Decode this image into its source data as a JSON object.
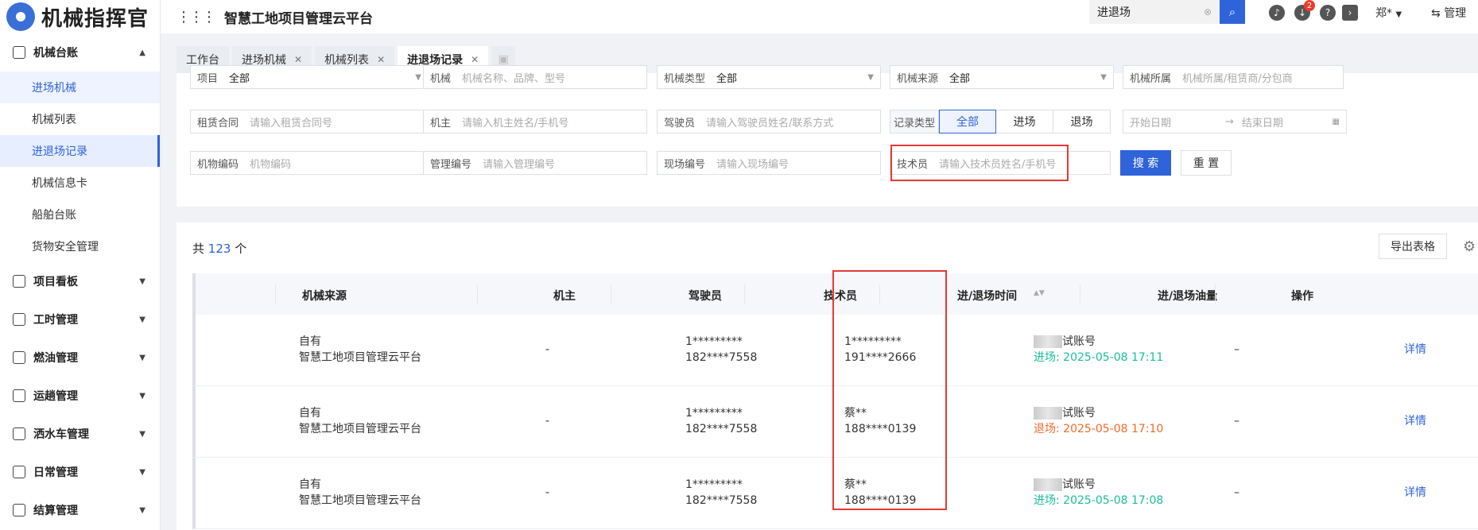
{
  "app": {
    "logo_text": "机械指挥官",
    "platform_title": "智慧工地项目管理云平台"
  },
  "sidebar": {
    "ledger": {
      "label": "机械台账",
      "icon": "ledger-icon",
      "expanded": true
    },
    "sub_items": [
      {
        "label": "进场机械",
        "state": "light"
      },
      {
        "label": "机械列表",
        "state": ""
      },
      {
        "label": "进退场记录",
        "state": "active"
      },
      {
        "label": "机械信息卡",
        "state": ""
      },
      {
        "label": "船舶台账",
        "state": ""
      },
      {
        "label": "货物安全管理",
        "state": ""
      }
    ],
    "groups": [
      {
        "label": "项目看板",
        "icon": "board-icon"
      },
      {
        "label": "工时管理",
        "icon": "clock-icon"
      },
      {
        "label": "燃油管理",
        "icon": "fuel-icon"
      },
      {
        "label": "运趟管理",
        "icon": "truck-icon"
      },
      {
        "label": "洒水车管理",
        "icon": "sprinkler-icon"
      },
      {
        "label": "日常管理",
        "icon": "clipboard-icon"
      },
      {
        "label": "结算管理",
        "icon": "settlement-icon"
      }
    ]
  },
  "header": {
    "search_value": "进退场",
    "badge_count": "2",
    "user": "郑*",
    "admin": "管理"
  },
  "tabs": [
    {
      "label": "工作台",
      "closable": false
    },
    {
      "label": "进场机械",
      "closable": true
    },
    {
      "label": "机械列表",
      "closable": true
    },
    {
      "label": "进退场记录",
      "closable": true,
      "active": true
    }
  ],
  "filters": {
    "project": {
      "label": "项目",
      "value": "全部"
    },
    "machine": {
      "label": "机械",
      "placeholder": "机械名称、品牌、型号"
    },
    "machine_type": {
      "label": "机械类型",
      "value": "全部"
    },
    "machine_source": {
      "label": "机械来源",
      "value": "全部"
    },
    "machine_owner_org": {
      "label": "机械所属",
      "placeholder": "机械所属/租赁商/分包商"
    },
    "lease_contract": {
      "label": "租赁合同",
      "placeholder": "请输入租赁合同号"
    },
    "owner": {
      "label": "机主",
      "placeholder": "请输入机主姓名/手机号"
    },
    "driver": {
      "label": "驾驶员",
      "placeholder": "请输入驾驶员姓名/联系方式"
    },
    "record_type": {
      "label": "记录类型",
      "options": [
        "全部",
        "进场",
        "退场"
      ],
      "selected": "全部"
    },
    "date_range": {
      "start": "开始日期",
      "arrow": "→",
      "end": "结束日期"
    },
    "asset_code": {
      "label": "机物编码",
      "placeholder": "机物编码"
    },
    "mgmt_code": {
      "label": "管理编号",
      "placeholder": "请输入管理编号"
    },
    "site_code": {
      "label": "现场编号",
      "placeholder": "请输入现场编号"
    },
    "technician": {
      "label": "技术员",
      "placeholder": "请输入技术员姓名/手机号"
    },
    "search_btn": "搜 索",
    "reset_btn": "重 置"
  },
  "table": {
    "total_prefix": "共",
    "total": "123",
    "total_suffix": "个",
    "export_label": "导出表格",
    "columns": [
      "机械来源",
      "机主",
      "驾驶员",
      "技术员",
      "进/退场时间",
      "进/退场油量",
      "操作"
    ],
    "rows": [
      {
        "source1": "自有",
        "source2": "智慧工地项目管理云平台",
        "owner": "-",
        "driver1": "1*********",
        "driver2": "182****7558",
        "tech1": "1*********",
        "tech2": "191****2666",
        "account": "试账号",
        "dir_label": "进场:",
        "dir": "in",
        "time": "2025-05-08 17:11",
        "oil": "–",
        "action": "详情"
      },
      {
        "source1": "自有",
        "source2": "智慧工地项目管理云平台",
        "owner": "-",
        "driver1": "1*********",
        "driver2": "182****7558",
        "tech1": "蔡**",
        "tech2": "188****0139",
        "account": "试账号",
        "dir_label": "退场:",
        "dir": "out",
        "time": "2025-05-08 17:10",
        "oil": "–",
        "action": "详情"
      },
      {
        "source1": "自有",
        "source2": "智慧工地项目管理云平台",
        "owner": "-",
        "driver1": "1*********",
        "driver2": "182****7558",
        "tech1": "蔡**",
        "tech2": "188****0139",
        "account": "试账号",
        "dir_label": "进场:",
        "dir": "in",
        "time": "2025-05-08 17:08",
        "oil": "–",
        "action": "详情"
      }
    ]
  }
}
